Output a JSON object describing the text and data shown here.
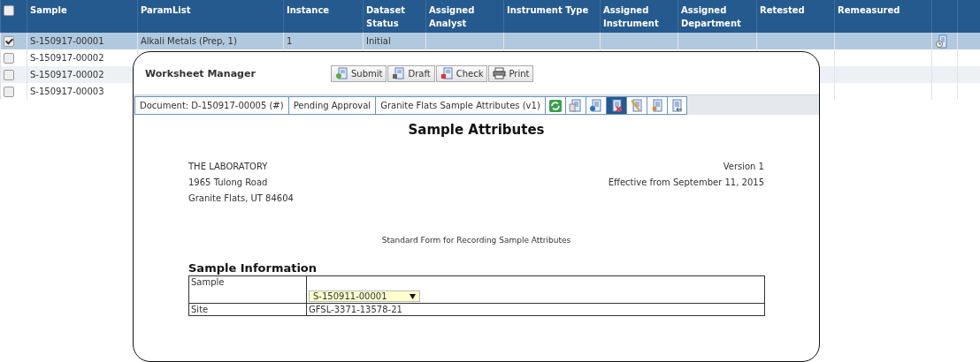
{
  "table": {
    "header_checked": false,
    "columns": [
      "Sample",
      "ParamList",
      "Instance",
      "Dataset Status",
      "Assigned Analyst",
      "Instrument Type",
      "Assigned Instrument",
      "Assigned Department",
      "Retested",
      "Remeasured"
    ],
    "rows": [
      {
        "checked": true,
        "selected": true,
        "doc_icon": true,
        "cells": [
          "S-150917-00001",
          "Alkali Metals (Prep, 1)",
          "1",
          "Initial"
        ]
      },
      {
        "checked": false,
        "selected": false,
        "doc_icon": false,
        "cells": [
          "S-150917-00002"
        ]
      },
      {
        "checked": false,
        "selected": false,
        "doc_icon": false,
        "cells": [
          "S-150917-00002"
        ]
      },
      {
        "checked": false,
        "selected": false,
        "doc_icon": false,
        "cells": [
          "S-150917-00003"
        ]
      }
    ]
  },
  "dialog": {
    "title": "Worksheet Manager",
    "buttons": [
      {
        "label": "Submit",
        "kind": "submit"
      },
      {
        "label": "Draft",
        "kind": "draft"
      },
      {
        "label": "Check",
        "kind": "check"
      },
      {
        "label": "Print",
        "kind": "print"
      }
    ],
    "info": [
      "Document: D-150917-00005 (#)",
      "Pending Approval",
      "Granite Flats Sample Attributes (v1)"
    ],
    "tools": [
      {
        "kind": "refresh",
        "selected": false
      },
      {
        "kind": "copy",
        "selected": false
      },
      {
        "kind": "globe",
        "selected": false
      },
      {
        "kind": "delete",
        "selected": true
      },
      {
        "kind": "edit",
        "selected": false
      },
      {
        "kind": "user",
        "selected": false
      },
      {
        "kind": "back",
        "selected": false
      }
    ],
    "doc": {
      "title": "Sample Attributes",
      "address": [
        "THE LABORATORY",
        "1965 Tulong Road",
        "Granite Flats, UT 84604"
      ],
      "version": [
        "Version 1",
        "Effective from September 11, 2015"
      ],
      "subtitle": "Standard Form for Recording Sample Attributes",
      "section": "Sample Information",
      "fields": [
        {
          "label": "Sample",
          "kind": "select",
          "value": "S-150911-00001"
        },
        {
          "label": "Site",
          "kind": "text",
          "value": "GFSL-3371-13578-21"
        }
      ]
    }
  }
}
